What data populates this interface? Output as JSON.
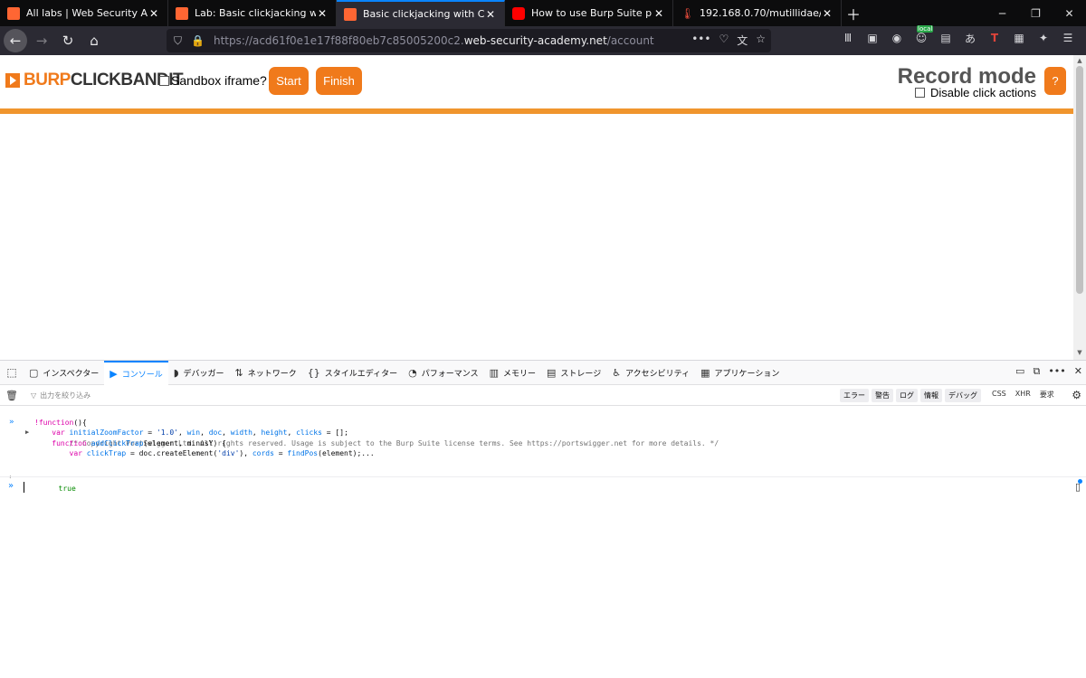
{
  "browser": {
    "tabs": [
      {
        "title": "All labs | Web Security Academy",
        "icon": "burp-icon"
      },
      {
        "title": "Lab: Basic clickjacking with CSRF",
        "icon": "burp-icon"
      },
      {
        "title": "Basic clickjacking with CSRF token",
        "icon": "burp-icon",
        "active": true
      },
      {
        "title": "How to use Burp Suite projects",
        "icon": "youtube-icon"
      },
      {
        "title": "192.168.0.70/mutillidae/",
        "icon": "thermometer-icon"
      }
    ],
    "url_prefix": "https://acd61f0e1e17f88f80eb7c85005200c2.",
    "url_domain": "web-security-academy.net",
    "url_path": "/account",
    "accent": "#0a84ff"
  },
  "clickbandit": {
    "logo_a": "BURP",
    "logo_b": "CLICKBANDIT",
    "sandbox_label": "Sandbox iframe?",
    "start_label": "Start",
    "finish_label": "Finish",
    "mode_title": "Record mode",
    "disable_label": "Disable click actions",
    "help_label": "?",
    "accent": "#f07a1b"
  },
  "devtools": {
    "tabs": [
      {
        "label": "インスペクター",
        "icon": "inspector-icon"
      },
      {
        "label": "コンソール",
        "icon": "console-icon",
        "active": true
      },
      {
        "label": "デバッガー",
        "icon": "debugger-icon"
      },
      {
        "label": "ネットワーク",
        "icon": "network-icon"
      },
      {
        "label": "スタイルエディター",
        "icon": "style-editor-icon"
      },
      {
        "label": "パフォーマンス",
        "icon": "performance-icon"
      },
      {
        "label": "メモリー",
        "icon": "memory-icon"
      },
      {
        "label": "ストレージ",
        "icon": "storage-icon"
      },
      {
        "label": "アクセシビリティ",
        "icon": "accessibility-icon"
      },
      {
        "label": "アプリケーション",
        "icon": "application-icon"
      }
    ],
    "filter_placeholder": "出力を絞り込み",
    "levels": [
      "エラー",
      "警告",
      "ログ",
      "情報",
      "デバッグ"
    ],
    "categories": [
      "CSS",
      "XHR",
      "要求"
    ],
    "console": {
      "line1": "/* Copyright PortSwigger Ltd. All rights reserved. Usage is subject to the Burp Suite license terms. See https://portswigger.net for more details. */",
      "line2_kw": "!function",
      "line2_rest": "(){",
      "line3_a": "    var ",
      "line3_b": "initialZoomFactor",
      "line3_c": " = ",
      "line3_d": "'1.0'",
      "line3_e": ", ",
      "line3_f": "win",
      "line3_g": ", ",
      "line3_h": "doc",
      "line3_i": ", ",
      "line3_j": "width",
      "line3_k": ", ",
      "line3_l": "height",
      "line3_m": ", ",
      "line3_n": "clicks",
      "line3_o": " = [];",
      "line4_kw": "    function ",
      "line4_fn": "addClickTrap",
      "line4_rest": "(element, minusY) {",
      "line5_kw": "        var ",
      "line5_fn": "clickTrap",
      "line5_b": " = doc.createElement(",
      "line5_st": "'div'",
      "line5_c": "), ",
      "line5_fn2": "cords",
      "line5_d": " = ",
      "line5_fn3": "findPos",
      "line5_e": "(element);...",
      "result": "true"
    }
  }
}
